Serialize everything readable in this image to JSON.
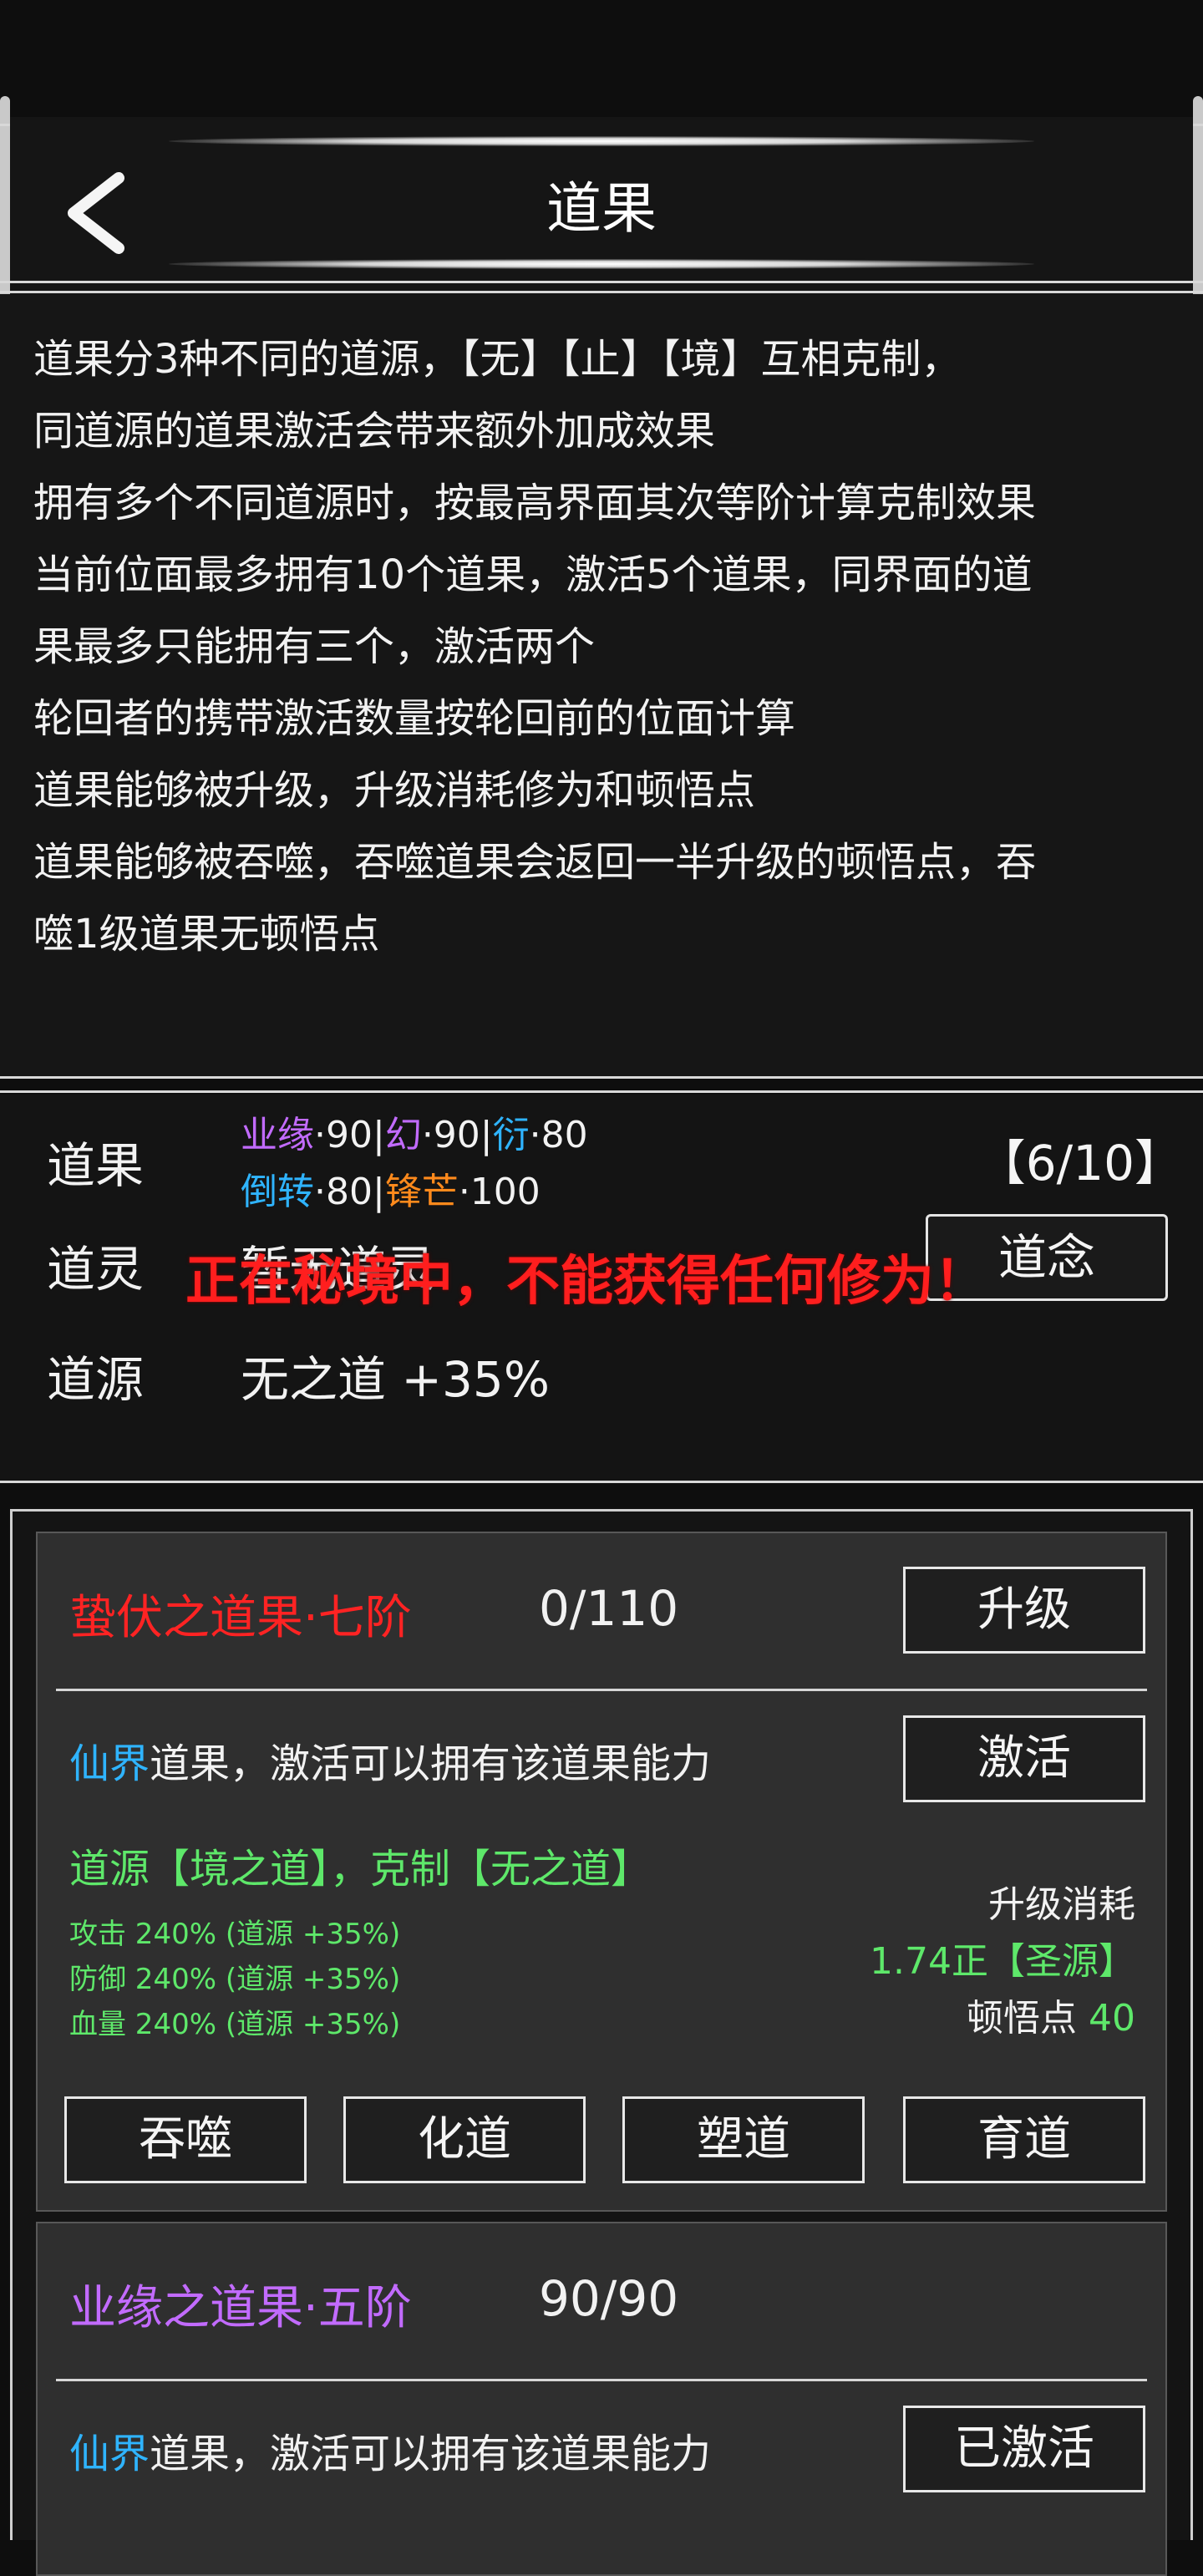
{
  "page": {
    "title": "道果",
    "back_icon": "chevron-left-icon"
  },
  "rules": [
    "道果分3种不同的道源，【无】【止】【境】互相克制，",
    "同道源的道果激活会带来额外加成效果",
    "拥有多个不同道源时，按最高界面其次等阶计算克制效果",
    "当前位面最多拥有10个道果，激活5个道果，同界面的道",
    "果最多只能拥有三个，激活两个",
    "轮回者的携带激活数量按轮回前的位面计算",
    "道果能够被升级，升级消耗修为和顿悟点",
    "道果能够被吞噬，吞噬道果会返回一半升级的顿悟点，吞",
    "噬1级道果无顿悟点"
  ],
  "status": {
    "daoguo_label": "道果",
    "row1": [
      {
        "name": "业缘",
        "value": "·90",
        "color": "purple"
      },
      {
        "sep": "|"
      },
      {
        "name": "幻",
        "value": "·90",
        "color": "purple"
      },
      {
        "sep": "|"
      },
      {
        "name": "衍",
        "value": "·80",
        "color": "cyan"
      }
    ],
    "row2": [
      {
        "name": "倒转",
        "value": "·80",
        "color": "cyan"
      },
      {
        "sep": "|"
      },
      {
        "name": "锋芒",
        "value": "·100",
        "color": "orange"
      }
    ],
    "count": "【6/10】",
    "daoling_label": "道灵",
    "daoling_value": "暂无道灵",
    "daonian_button": "道念",
    "daoyuan_label": "道源",
    "daoyuan_value": "无之道 +35%",
    "warning": "正在秘境中，不能获得任何修为！"
  },
  "cards": [
    {
      "name": "蛰伏之道果·七阶",
      "name_color": "#ff2323",
      "progress_text": "0/110",
      "upgrade_button": "升级",
      "realm": "仙界",
      "desc": "道果，激活可以拥有该道果能力",
      "activate_button": "激活",
      "source_line": "道源【境之道】，克制【无之道】",
      "stats": [
        "攻击 240% (道源 +35%)",
        "防御 240% (道源 +35%)",
        "血量 240% (道源 +35%)"
      ],
      "cost_label": "升级消耗",
      "cost_value": "1.74正【圣源】",
      "insight_label": "顿悟点",
      "insight_value": "40",
      "actions": [
        "吞噬",
        "化道",
        "塑道",
        "育道"
      ]
    },
    {
      "name": "业缘之道果·五阶",
      "name_color": "#c26bff",
      "progress_text": "90/90",
      "realm": "仙界",
      "desc": "道果，激活可以拥有该道果能力",
      "activate_button": "已激活"
    }
  ]
}
